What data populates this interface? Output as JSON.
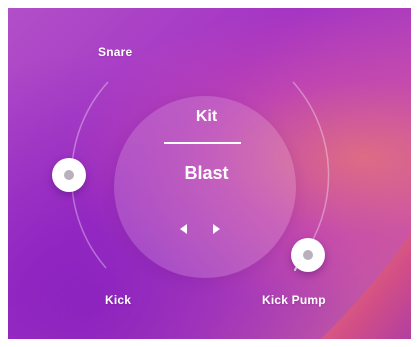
{
  "kit": {
    "title": "Kit",
    "value": "Blast"
  },
  "labels": {
    "snare": "Snare",
    "kick": "Kick",
    "kick_pump": "Kick Pump"
  },
  "icons": {
    "prev": "caret-left-icon",
    "next": "caret-right-icon"
  },
  "colors": {
    "background_primary": "#a434c4",
    "background_warm": "#e0707a",
    "knob": "#ffffff",
    "knob_dot": "#b8b0bc",
    "text": "#ffffff"
  }
}
